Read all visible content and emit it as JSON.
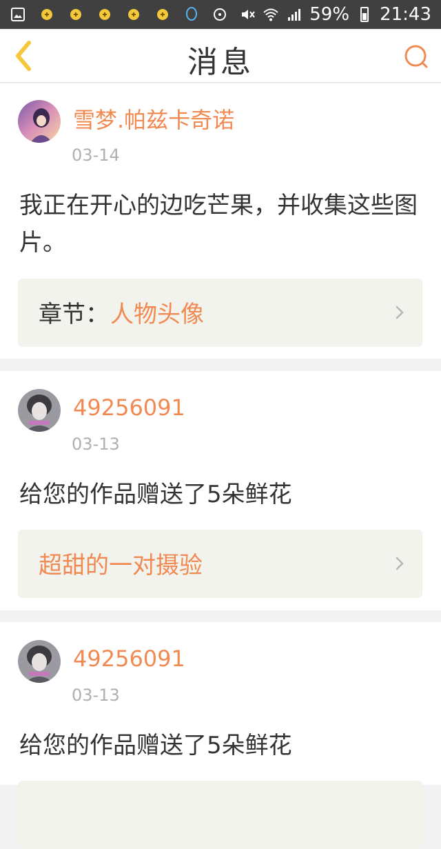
{
  "status_bar": {
    "battery": "59%",
    "time": "21:43",
    "icons": [
      "gallery-icon",
      "app-notification-icon",
      "app-notification-icon",
      "app-notification-icon",
      "app-notification-icon",
      "app-notification-icon",
      "qq-icon",
      "media-icon",
      "mute-icon",
      "wifi-icon",
      "signal-icon",
      "battery-icon"
    ]
  },
  "header": {
    "title": "消息",
    "back_icon": "chevron-left-icon",
    "search_icon": "search-icon",
    "accent": "#f08a52"
  },
  "messages": [
    {
      "username": "雪梦.帕兹卡奇诺",
      "date": "03-14",
      "text": "我正在开心的边吃芒果，并收集这些图片。",
      "link_prefix": "章节：",
      "link_text": "人物头像"
    },
    {
      "username": "49256091",
      "date": "03-13",
      "text": "给您的作品赠送了5朵鲜花",
      "link_text": "超甜的一对摄验"
    },
    {
      "username": "49256091",
      "date": "03-13",
      "text": "给您的作品赠送了5朵鲜花"
    }
  ]
}
